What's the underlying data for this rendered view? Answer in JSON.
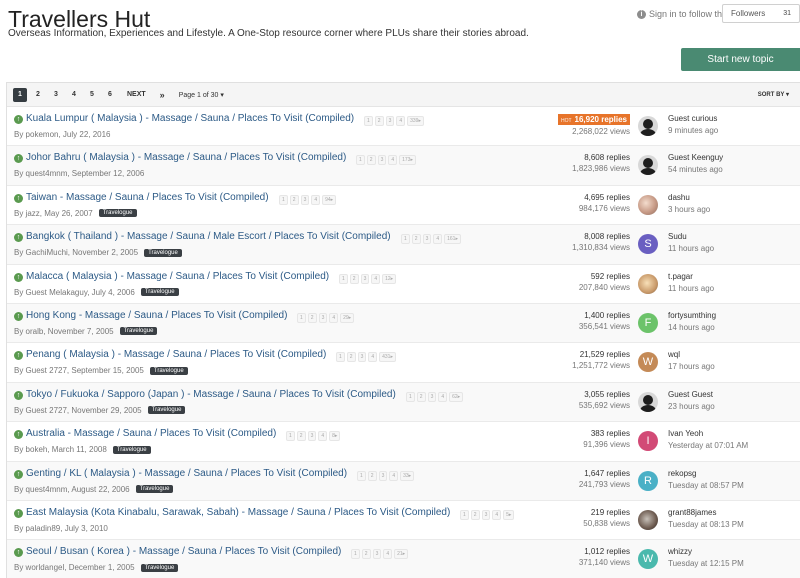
{
  "forum": {
    "title": "Travellers Hut",
    "description": "Overseas Information, Experiences and Lifestyle. A One-Stop resource corner where PLUs share their stories abroad."
  },
  "header": {
    "signin_text": "Sign in to follow this",
    "followers_label": "Followers",
    "followers_count": "31",
    "start_topic_label": "Start new topic"
  },
  "pagination": {
    "pages": [
      "1",
      "2",
      "3",
      "4",
      "5",
      "6"
    ],
    "next_label": "NEXT",
    "last_label": "»",
    "page_of": "Page 1 of 30 ▾",
    "sort_label": "SORT BY ▾"
  },
  "topics": [
    {
      "title": "Kuala Lumpur ( Malaysia ) - Massage / Sauna / Places To Visit (Compiled)",
      "mini_pages": [
        "1",
        "2",
        "3",
        "4",
        "339▸"
      ],
      "byline": "By pokemon, July 22, 2016",
      "tag": "",
      "hot_label": "HOT",
      "replies": "16,920 replies",
      "views": "2,268,022 views",
      "last_poster": "Guest curious",
      "last_time": "9 minutes ago",
      "avatar_letter": "",
      "avatar_color": "#d8d8d8",
      "avatar_kind": "default"
    },
    {
      "title": "Johor Bahru ( Malaysia ) - Massage / Sauna / Places To Visit (Compiled)",
      "mini_pages": [
        "1",
        "2",
        "3",
        "4",
        "173▸"
      ],
      "byline": "By quest4mnm, September 12, 2006",
      "tag": "",
      "hot_label": "",
      "replies": "8,608 replies",
      "views": "1,823,986 views",
      "last_poster": "Guest Keenguy",
      "last_time": "54 minutes ago",
      "avatar_letter": "",
      "avatar_color": "#d8d8d8",
      "avatar_kind": "default"
    },
    {
      "title": "Taiwan - Massage / Sauna / Places To Visit (Compiled)",
      "mini_pages": [
        "1",
        "2",
        "3",
        "4",
        "94▸"
      ],
      "byline": "By jazz, May 26, 2007",
      "tag": "Travelogue",
      "hot_label": "",
      "replies": "4,695 replies",
      "views": "984,176 views",
      "last_poster": "dashu",
      "last_time": "3 hours ago",
      "avatar_letter": "",
      "avatar_color": "#c79a86",
      "avatar_kind": "photo"
    },
    {
      "title": "Bangkok ( Thailand ) - Massage / Sauna / Male Escort / Places To Visit (Compiled)",
      "mini_pages": [
        "1",
        "2",
        "3",
        "4",
        "161▸"
      ],
      "byline": "By GachiMuchi, November 2, 2005",
      "tag": "Travelogue",
      "hot_label": "",
      "replies": "8,008 replies",
      "views": "1,310,834 views",
      "last_poster": "Sudu",
      "last_time": "11 hours ago",
      "avatar_letter": "S",
      "avatar_color": "#6a5fc1",
      "avatar_kind": "letter"
    },
    {
      "title": "Malacca ( Malaysia ) - Massage / Sauna / Places To Visit (Compiled)",
      "mini_pages": [
        "1",
        "2",
        "3",
        "4",
        "12▸"
      ],
      "byline": "By Guest Melakaguy, July 4, 2006",
      "tag": "Travelogue",
      "hot_label": "",
      "replies": "592 replies",
      "views": "207,840 views",
      "last_poster": "t.pagar",
      "last_time": "11 hours ago",
      "avatar_letter": "",
      "avatar_color": "#c99a6a",
      "avatar_kind": "photo2"
    },
    {
      "title": "Hong Kong - Massage / Sauna / Places To Visit (Compiled)",
      "mini_pages": [
        "1",
        "2",
        "3",
        "4",
        "29▸"
      ],
      "byline": "By oralb, November 7, 2005",
      "tag": "Travelogue",
      "hot_label": "",
      "replies": "1,400 replies",
      "views": "356,541 views",
      "last_poster": "fortysumthing",
      "last_time": "14 hours ago",
      "avatar_letter": "F",
      "avatar_color": "#6cc36a",
      "avatar_kind": "letter"
    },
    {
      "title": "Penang ( Malaysia ) - Massage / Sauna / Places To Visit (Compiled)",
      "mini_pages": [
        "1",
        "2",
        "3",
        "4",
        "431▸"
      ],
      "byline": "By Guest 2727, September 15, 2005",
      "tag": "Travelogue",
      "hot_label": "",
      "replies": "21,529 replies",
      "views": "1,251,772 views",
      "last_poster": "wql",
      "last_time": "17 hours ago",
      "avatar_letter": "W",
      "avatar_color": "#c48a57",
      "avatar_kind": "letter"
    },
    {
      "title": "Tokyo / Fukuoka / Sapporo (Japan ) - Massage / Sauna / Places To Visit (Compiled)",
      "mini_pages": [
        "1",
        "2",
        "3",
        "4",
        "62▸"
      ],
      "byline": "By Guest 2727, November 29, 2005",
      "tag": "Travelogue",
      "hot_label": "",
      "replies": "3,055 replies",
      "views": "535,692 views",
      "last_poster": "Guest Guest",
      "last_time": "23 hours ago",
      "avatar_letter": "",
      "avatar_color": "#d8d8d8",
      "avatar_kind": "default"
    },
    {
      "title": "Australia - Massage / Sauna / Places To Visit (Compiled)",
      "mini_pages": [
        "1",
        "2",
        "3",
        "4",
        "8▸"
      ],
      "byline": "By bokeh, March 11, 2008",
      "tag": "Travelogue",
      "hot_label": "",
      "replies": "383 replies",
      "views": "91,396 views",
      "last_poster": "Ivan Yeoh",
      "last_time": "Yesterday at 07:01 AM",
      "avatar_letter": "I",
      "avatar_color": "#d24a76",
      "avatar_kind": "letter"
    },
    {
      "title": "Genting / KL ( Malaysia ) - Massage / Sauna / Places To Visit (Compiled)",
      "mini_pages": [
        "1",
        "2",
        "3",
        "4",
        "33▸"
      ],
      "byline": "By quest4mnm, August 22, 2006",
      "tag": "Travelogue",
      "hot_label": "",
      "replies": "1,647 replies",
      "views": "241,793 views",
      "last_poster": "rekopsg",
      "last_time": "Tuesday at 08:57 PM",
      "avatar_letter": "R",
      "avatar_color": "#4ab0c6",
      "avatar_kind": "letter"
    },
    {
      "title": "East Malaysia (Kota Kinabalu, Sarawak, Sabah) - Massage / Sauna / Places To Visit (Compiled)",
      "mini_pages": [
        "1",
        "2",
        "3",
        "4",
        "5▸"
      ],
      "byline": "By paladin89, July 3, 2010",
      "tag": "",
      "hot_label": "",
      "replies": "219 replies",
      "views": "50,838 views",
      "last_poster": "grant88james",
      "last_time": "Tuesday at 08:13 PM",
      "avatar_letter": "",
      "avatar_color": "#6c5a4f",
      "avatar_kind": "photo3"
    },
    {
      "title": "Seoul / Busan ( Korea ) - Massage / Sauna / Places To Visit (Compiled)",
      "mini_pages": [
        "1",
        "2",
        "3",
        "4",
        "21▸"
      ],
      "byline": "By worldangel, December 1, 2005",
      "tag": "Travelogue",
      "hot_label": "",
      "replies": "1,012 replies",
      "views": "371,140 views",
      "last_poster": "whizzy",
      "last_time": "Tuesday at 12:15 PM",
      "avatar_letter": "W",
      "avatar_color": "#4ab9ad",
      "avatar_kind": "letter"
    }
  ],
  "icons": {
    "info": "info-icon",
    "topic_status": "arrow-up-icon"
  },
  "colors": {
    "accent": "#4a8a72",
    "link": "#2c5a86",
    "hot": "#e7742a",
    "status_dot": "#5a9a4f"
  }
}
